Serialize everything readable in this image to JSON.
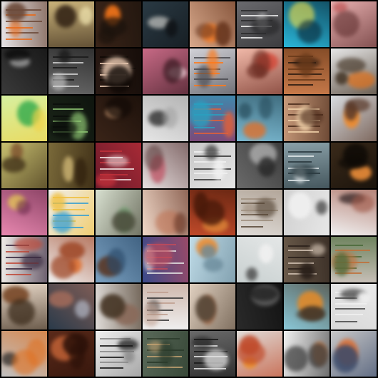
{
  "grid": {
    "rows": 8,
    "cols": 8,
    "tiles": [
      {
        "bg": "#e6e4e6",
        "accent": "#e86a1a",
        "shade": "#6c4a3a",
        "kind": "text"
      },
      {
        "bg": "#c9b27a",
        "accent": "#f2e6b0",
        "shade": "#3a2a1a",
        "kind": "blob"
      },
      {
        "bg": "#3a2418",
        "accent": "#ff7a1a",
        "shade": "#1a120c",
        "kind": "fire"
      },
      {
        "bg": "#2a3a44",
        "accent": "#e8e6e0",
        "shade": "#101418",
        "kind": "blob"
      },
      {
        "bg": "#d8a98c",
        "accent": "#ff7a1a",
        "shade": "#6a3820",
        "kind": "fire"
      },
      {
        "bg": "#6a6a6e",
        "accent": "#f0f0f0",
        "shade": "#2a2a2c",
        "kind": "text"
      },
      {
        "bg": "#2ab6d8",
        "accent": "#f2e24a",
        "shade": "#0a2a3a",
        "kind": "blob"
      },
      {
        "bg": "#e8b0b0",
        "accent": "#c05a5a",
        "shade": "#5a2a2a",
        "kind": "blob"
      },
      {
        "bg": "#3a3a3a",
        "accent": "#bcbcbc",
        "shade": "#0c0c0c",
        "kind": "blob"
      },
      {
        "bg": "#6a6a6a",
        "accent": "#d0d0d0",
        "shade": "#1a1a1a",
        "kind": "text"
      },
      {
        "bg": "#2a1a14",
        "accent": "#e8c8b0",
        "shade": "#0e0805",
        "kind": "text"
      },
      {
        "bg": "#c86a86",
        "accent": "#f0d0d8",
        "shade": "#3a1a22",
        "kind": "blob"
      },
      {
        "bg": "#d2d2d8",
        "accent": "#ff7a1a",
        "shade": "#4a4a50",
        "kind": "text"
      },
      {
        "bg": "#f0b8a8",
        "accent": "#d83a2a",
        "shade": "#6a2a20",
        "kind": "fire"
      },
      {
        "bg": "#c87a4a",
        "accent": "#2a1a10",
        "shade": "#6a3a1a",
        "kind": "text"
      },
      {
        "bg": "#e6e6e6",
        "accent": "#e0701a",
        "shade": "#3a2a1a",
        "kind": "fire"
      },
      {
        "bg": "#d6f0a0",
        "accent": "#2aa84a",
        "shade": "#f0d24a",
        "kind": "blob"
      },
      {
        "bg": "#1a2418",
        "accent": "#8ac070",
        "shade": "#0a0e0a",
        "kind": "text"
      },
      {
        "bg": "#3a2418",
        "accent": "#c0906a",
        "shade": "#120a06",
        "kind": "blob"
      },
      {
        "bg": "#e6e6e6",
        "accent": "#2a2a2a",
        "shade": "#a0a0a0",
        "kind": "blob"
      },
      {
        "bg": "#7a4a7a",
        "accent": "#e0603a",
        "shade": "#2aa0c0",
        "kind": "text"
      },
      {
        "bg": "#7ab8d0",
        "accent": "#e0702a",
        "shade": "#2a5060",
        "kind": "fire"
      },
      {
        "bg": "#c89a7a",
        "accent": "#f0d0a8",
        "shade": "#4a2a1a",
        "kind": "text"
      },
      {
        "bg": "#d8dce0",
        "accent": "#f08a2a",
        "shade": "#5a3a2a",
        "kind": "fire"
      },
      {
        "bg": "#c8c070",
        "accent": "#7a4a2a",
        "shade": "#3a2a14",
        "kind": "blob"
      },
      {
        "bg": "#7a6a3a",
        "accent": "#c8b070",
        "shade": "#2a1a0a",
        "kind": "blob"
      },
      {
        "bg": "#6a1a2a",
        "accent": "#f0e0e0",
        "shade": "#c0303a",
        "kind": "text"
      },
      {
        "bg": "#e8e0e0",
        "accent": "#c05a6a",
        "shade": "#5a3a3a",
        "kind": "blob"
      },
      {
        "bg": "#c8c8c8",
        "accent": "#3a3a3a",
        "shade": "#f0f0f0",
        "kind": "text"
      },
      {
        "bg": "#6a6a6a",
        "accent": "#d0d0d0",
        "shade": "#2a2a2a",
        "kind": "blob"
      },
      {
        "bg": "#8aa0a8",
        "accent": "#e0e8ea",
        "shade": "#2a3a40",
        "kind": "text"
      },
      {
        "bg": "#3a2a1a",
        "accent": "#f0903a",
        "shade": "#0e0a06",
        "kind": "fire"
      },
      {
        "bg": "#e888b0",
        "accent": "#f0e04a",
        "shade": "#6a2a4a",
        "kind": "blob"
      },
      {
        "bg": "#f0f0f0",
        "accent": "#3aa0d0",
        "shade": "#f0c040",
        "kind": "text"
      },
      {
        "bg": "#d8e0d0",
        "accent": "#6a9a6a",
        "shade": "#4a4a3a",
        "kind": "blob"
      },
      {
        "bg": "#f0d8c8",
        "accent": "#c07050",
        "shade": "#6a3a2a",
        "kind": "blob"
      },
      {
        "bg": "#c04a2a",
        "accent": "#f0a040",
        "shade": "#4a1a0a",
        "kind": "fire"
      },
      {
        "bg": "#e0dcd8",
        "accent": "#5a4a3a",
        "shade": "#a09080",
        "kind": "text"
      },
      {
        "bg": "#d0d0d0",
        "accent": "#3a3a3a",
        "shade": "#f0f0f0",
        "kind": "blob"
      },
      {
        "bg": "#f0f0f0",
        "accent": "#3a2a2a",
        "shade": "#a05a4a",
        "kind": "blob"
      },
      {
        "bg": "#f0ece8",
        "accent": "#c04a3a",
        "shade": "#3a2a40",
        "kind": "text"
      },
      {
        "bg": "#f0f0f0",
        "accent": "#e07030",
        "shade": "#a04a2a",
        "kind": "fire"
      },
      {
        "bg": "#7aa0c0",
        "accent": "#5a3a2a",
        "shade": "#2a4a6a",
        "kind": "blob"
      },
      {
        "bg": "#3a4a8a",
        "accent": "#e0e0e0",
        "shade": "#c04a5a",
        "kind": "text"
      },
      {
        "bg": "#c0dce8",
        "accent": "#f08a2a",
        "shade": "#6a8a9a",
        "kind": "fire"
      },
      {
        "bg": "#c8d0d0",
        "accent": "#3a3a3a",
        "shade": "#f0f0f0",
        "kind": "blob"
      },
      {
        "bg": "#6a5a4a",
        "accent": "#d0c0b0",
        "shade": "#2a201a",
        "kind": "text"
      },
      {
        "bg": "#c8c0b8",
        "accent": "#c0703a",
        "shade": "#4a6a3a",
        "kind": "text"
      },
      {
        "bg": "#e8d8c8",
        "accent": "#7a4a2a",
        "shade": "#3a2a1a",
        "kind": "blob"
      },
      {
        "bg": "#2a3a4a",
        "accent": "#c0c8d8",
        "shade": "#a06a5a",
        "kind": "blob"
      },
      {
        "bg": "#e0dcd8",
        "accent": "#8a6a5a",
        "shade": "#4a3a2a",
        "kind": "blob"
      },
      {
        "bg": "#f0f0f0",
        "accent": "#3a3a3a",
        "shade": "#c0a090",
        "kind": "text"
      },
      {
        "bg": "#e0d0c0",
        "accent": "#a06a4a",
        "shade": "#5a4a3a",
        "kind": "blob"
      },
      {
        "bg": "#2a2a2a",
        "accent": "#8a8a8a",
        "shade": "#0a0a0a",
        "kind": "blob"
      },
      {
        "bg": "#8ac8d8",
        "accent": "#e08a2a",
        "shade": "#4a3a2a",
        "kind": "fire"
      },
      {
        "bg": "#d8d8d8",
        "accent": "#4a4a4a",
        "shade": "#f0f0f0",
        "kind": "text"
      },
      {
        "bg": "#c0c0c0",
        "accent": "#1a1a1a",
        "shade": "#e07020",
        "kind": "fire"
      },
      {
        "bg": "#5a2a1a",
        "accent": "#d06a3a",
        "shade": "#2a1008",
        "kind": "fire"
      },
      {
        "bg": "#f0f0f0",
        "accent": "#1a1a1a",
        "shade": "#8a8a8a",
        "kind": "text"
      },
      {
        "bg": "#5a6a5a",
        "accent": "#c0a070",
        "shade": "#2a3a2a",
        "kind": "text"
      },
      {
        "bg": "#6a6a6a",
        "accent": "#e0e0e0",
        "shade": "#1a1a1a",
        "kind": "text"
      },
      {
        "bg": "#e0dcd8",
        "accent": "#f09020",
        "shade": "#c04a2a",
        "kind": "fire"
      },
      {
        "bg": "#f0f0f0",
        "accent": "#e07020",
        "shade": "#3a3a3a",
        "kind": "fire"
      },
      {
        "bg": "#c8c8c8",
        "accent": "#e06a2a",
        "shade": "#3a4a6a",
        "kind": "fire"
      }
    ]
  }
}
